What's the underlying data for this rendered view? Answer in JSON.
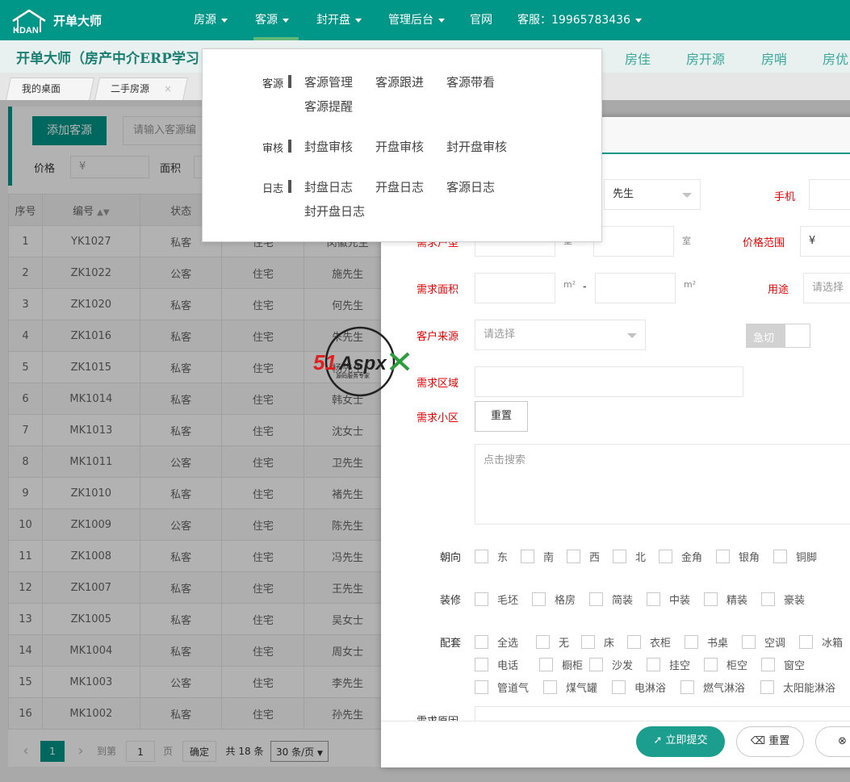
{
  "topnav": {
    "logo_text": "开单大师",
    "items": [
      {
        "label": "房源"
      },
      {
        "label": "客源"
      },
      {
        "label": "封开盘"
      },
      {
        "label": "管理后台"
      },
      {
        "label": "官网"
      },
      {
        "label": "客服：19965783436"
      }
    ]
  },
  "banner": {
    "title": "开单大师（房产中介ERP学习",
    "links": [
      "房佳",
      "房开源",
      "房哨",
      "房优"
    ]
  },
  "tabs": [
    {
      "label": "我的桌面"
    },
    {
      "label": "二手房源",
      "close": "×"
    }
  ],
  "toolbar": {
    "add_label": "添加客源",
    "search_placeholder": "请输入客源编",
    "price_label": "价格",
    "price_placeholder": "¥",
    "area_label": "面积"
  },
  "table": {
    "headers": [
      "序号",
      "编号",
      "状态",
      "",
      ""
    ],
    "sort_glyph": "▲▼",
    "rows": [
      {
        "no": "1",
        "code": "YK1027",
        "color": "y",
        "status": "私客",
        "use": "住宅",
        "name": "闵徽先生"
      },
      {
        "no": "2",
        "code": "ZK1022",
        "color": "b",
        "status": "公客",
        "use": "住宅",
        "name": "施先生"
      },
      {
        "no": "3",
        "code": "ZK1020",
        "color": "b",
        "status": "私客",
        "use": "住宅",
        "name": "何先生"
      },
      {
        "no": "4",
        "code": "ZK1016",
        "color": "b",
        "status": "私客",
        "use": "住宅",
        "name": "朱先生"
      },
      {
        "no": "5",
        "code": "ZK1015",
        "color": "b",
        "status": "私客",
        "use": "住宅",
        "name": "杨先生"
      },
      {
        "no": "6",
        "code": "MK1014",
        "color": "g",
        "status": "私客",
        "use": "住宅",
        "name": "韩女士"
      },
      {
        "no": "7",
        "code": "MK1013",
        "color": "g",
        "status": "私客",
        "use": "住宅",
        "name": "沈女士"
      },
      {
        "no": "8",
        "code": "MK1011",
        "color": "g",
        "status": "公客",
        "use": "住宅",
        "name": "卫先生"
      },
      {
        "no": "9",
        "code": "ZK1010",
        "color": "b",
        "status": "私客",
        "use": "住宅",
        "name": "褚先生"
      },
      {
        "no": "10",
        "code": "ZK1009",
        "color": "b",
        "status": "公客",
        "use": "住宅",
        "name": "陈先生"
      },
      {
        "no": "11",
        "code": "ZK1008",
        "color": "b",
        "status": "私客",
        "use": "住宅",
        "name": "冯先生"
      },
      {
        "no": "12",
        "code": "ZK1007",
        "color": "b",
        "status": "私客",
        "use": "住宅",
        "name": "王先生"
      },
      {
        "no": "13",
        "code": "ZK1005",
        "color": "b",
        "status": "私客",
        "use": "住宅",
        "name": "吴女士"
      },
      {
        "no": "14",
        "code": "MK1004",
        "color": "g",
        "status": "私客",
        "use": "住宅",
        "name": "周女士"
      },
      {
        "no": "15",
        "code": "MK1003",
        "color": "g",
        "status": "公客",
        "use": "住宅",
        "name": "李先生"
      },
      {
        "no": "16",
        "code": "MK1002",
        "color": "g",
        "status": "私客",
        "use": "住宅",
        "name": "孙先生"
      }
    ]
  },
  "pager": {
    "prev": "‹",
    "current": "1",
    "next": "›",
    "goto_prefix": "到第",
    "goto_value": "1",
    "goto_suffix": "页",
    "confirm": "确定",
    "total": "共 18 条",
    "per_page": "30 条/页"
  },
  "dropdown": {
    "groups": [
      {
        "cat": "客源",
        "links": [
          "客源管理",
          "客源跟进",
          "客源带看",
          "客源提醒"
        ]
      },
      {
        "cat": "审核",
        "links": [
          "封盘审核",
          "开盘审核",
          "封开盘审核"
        ]
      },
      {
        "cat": "日志",
        "links": [
          "封盘日志",
          "开盘日志",
          "客源日志",
          "封开盘日志"
        ]
      }
    ]
  },
  "form": {
    "gender_value": "先生",
    "phone_label": "手机",
    "room_label": "需求户型",
    "room_unit": "室",
    "price_range_label": "价格范围",
    "price_placeholder": "¥",
    "area_label": "需求面积",
    "area_unit": "m²",
    "range_sep": "-",
    "use_label": "用途",
    "use_placeholder": "请选择",
    "source_label": "客户来源",
    "source_placeholder": "请选择",
    "urgent_label": "急切",
    "region_label": "需求区域",
    "community_label": "需求小区",
    "reset_label": "重置",
    "search_placeholder": "点击搜索",
    "orientation_label": "朝向",
    "orientation_opts": [
      "东",
      "南",
      "西",
      "北",
      "金角",
      "银角",
      "铜脚"
    ],
    "decoration_label": "装修",
    "decoration_opts": [
      "毛坯",
      "格房",
      "简装",
      "中装",
      "精装",
      "豪装"
    ],
    "facility_label": "配套",
    "facility_row1": [
      "全选",
      "无",
      "床",
      "衣柜",
      "书桌",
      "空调",
      "冰箱"
    ],
    "facility_row2": [
      "电话",
      "橱柜",
      "沙发",
      "挂空",
      "柜空",
      "窗空"
    ],
    "facility_row3": [
      "管道气",
      "煤气罐",
      "电淋浴",
      "燃气淋浴",
      "太阳能淋浴"
    ],
    "reason_label": "需求原因"
  },
  "footer": {
    "submit": "立即提交",
    "reset": "重置",
    "close": "关"
  },
  "watermark": {
    "brand": "51Aspx",
    "tagline": "源码服务专家"
  }
}
